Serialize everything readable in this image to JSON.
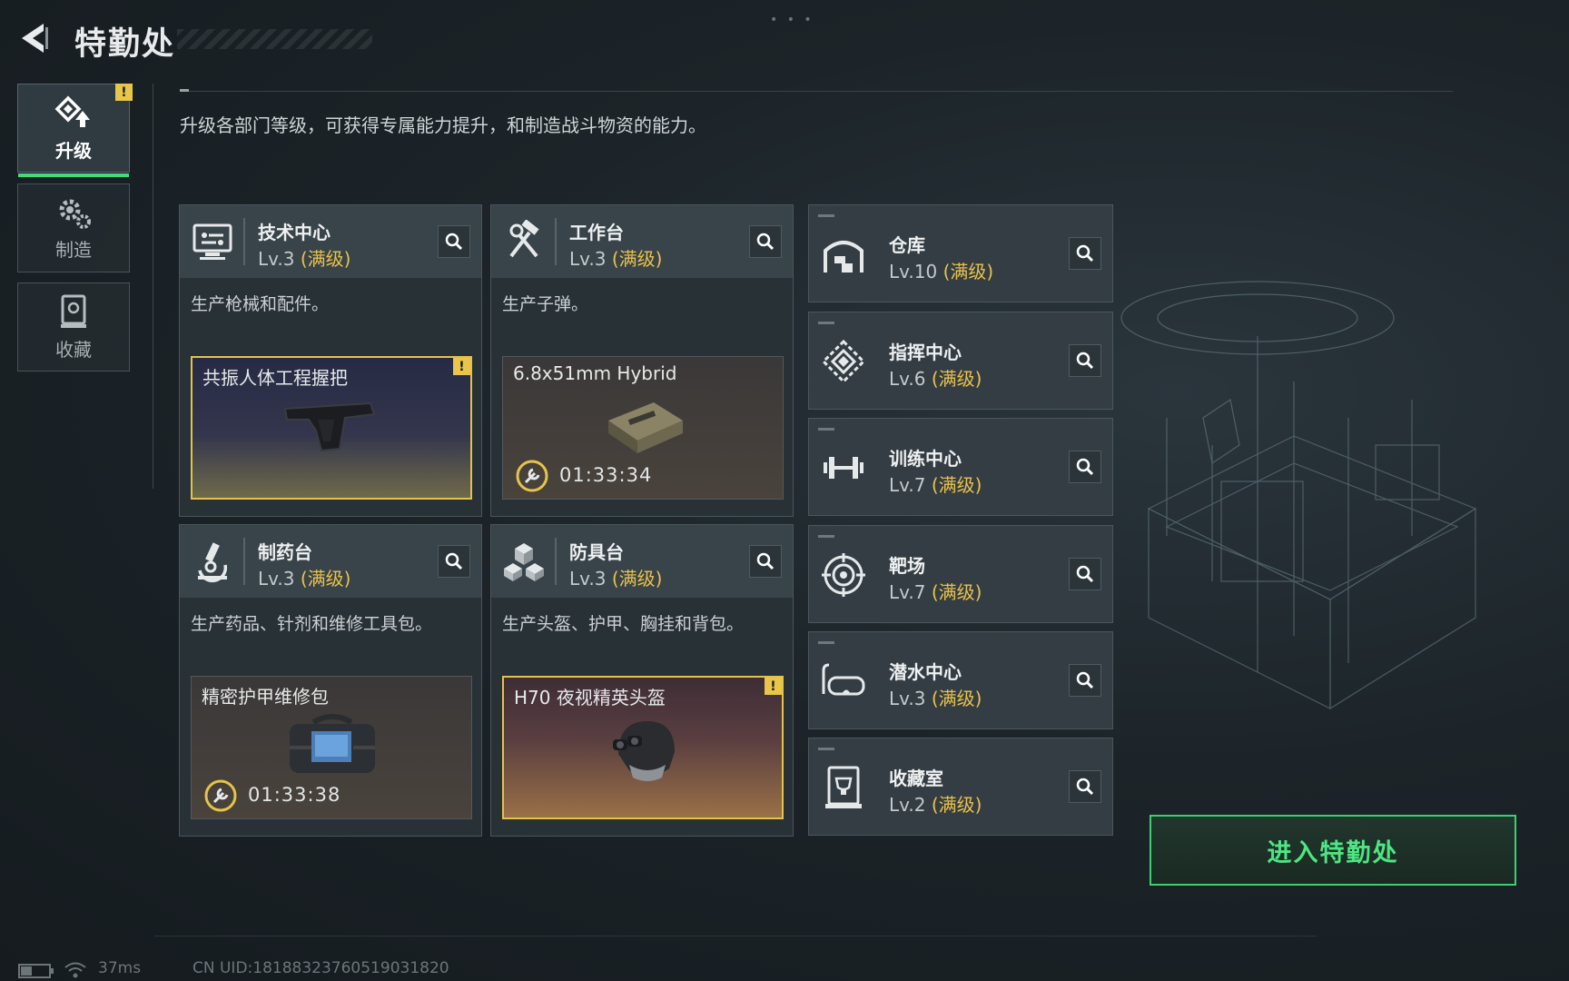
{
  "header": {
    "title": "特勤处",
    "dots": "• • •"
  },
  "sidebar": {
    "tabs": [
      {
        "label": "升级",
        "badge": "!",
        "active": true
      },
      {
        "label": "制造"
      },
      {
        "label": "收藏"
      }
    ]
  },
  "description": "升级各部门等级，可获得专属能力提升，和制造战斗物资的能力。",
  "max_label": "(满级)",
  "cards": [
    {
      "name": "技术中心",
      "level": "Lv.3",
      "desc": "生产枪械和配件。",
      "product": {
        "name": "共振人体工程握把",
        "timer": "",
        "badge": "!"
      }
    },
    {
      "name": "工作台",
      "level": "Lv.3",
      "desc": "生产子弹。",
      "product": {
        "name": "6.8x51mm Hybrid",
        "timer": "01:33:34"
      }
    },
    {
      "name": "制药台",
      "level": "Lv.3",
      "desc": "生产药品、针剂和维修工具包。",
      "product": {
        "name": "精密护甲维修包",
        "timer": "01:33:38"
      }
    },
    {
      "name": "防具台",
      "level": "Lv.3",
      "desc": "生产头盔、护甲、胸挂和背包。",
      "product": {
        "name": "H70 夜视精英头盔",
        "timer": "",
        "badge": "!"
      }
    }
  ],
  "facilities": [
    {
      "name": "仓库",
      "level": "Lv.10",
      "icon": "warehouse-icon"
    },
    {
      "name": "指挥中心",
      "level": "Lv.6",
      "icon": "command-center-icon"
    },
    {
      "name": "训练中心",
      "level": "Lv.7",
      "icon": "dumbbell-icon"
    },
    {
      "name": "靶场",
      "level": "Lv.7",
      "icon": "target-icon"
    },
    {
      "name": "潜水中心",
      "level": "Lv.3",
      "icon": "diving-mask-icon"
    },
    {
      "name": "收藏室",
      "level": "Lv.2",
      "icon": "trophy-case-icon"
    }
  ],
  "enter_button": "进入特勤处",
  "footer": {
    "ping": "37ms",
    "uid": "CN UID:18188323760519031820"
  },
  "colors": {
    "accent_green": "#3fdc7e",
    "max_gold": "#e8c24a",
    "warning": "#e7c64a"
  }
}
